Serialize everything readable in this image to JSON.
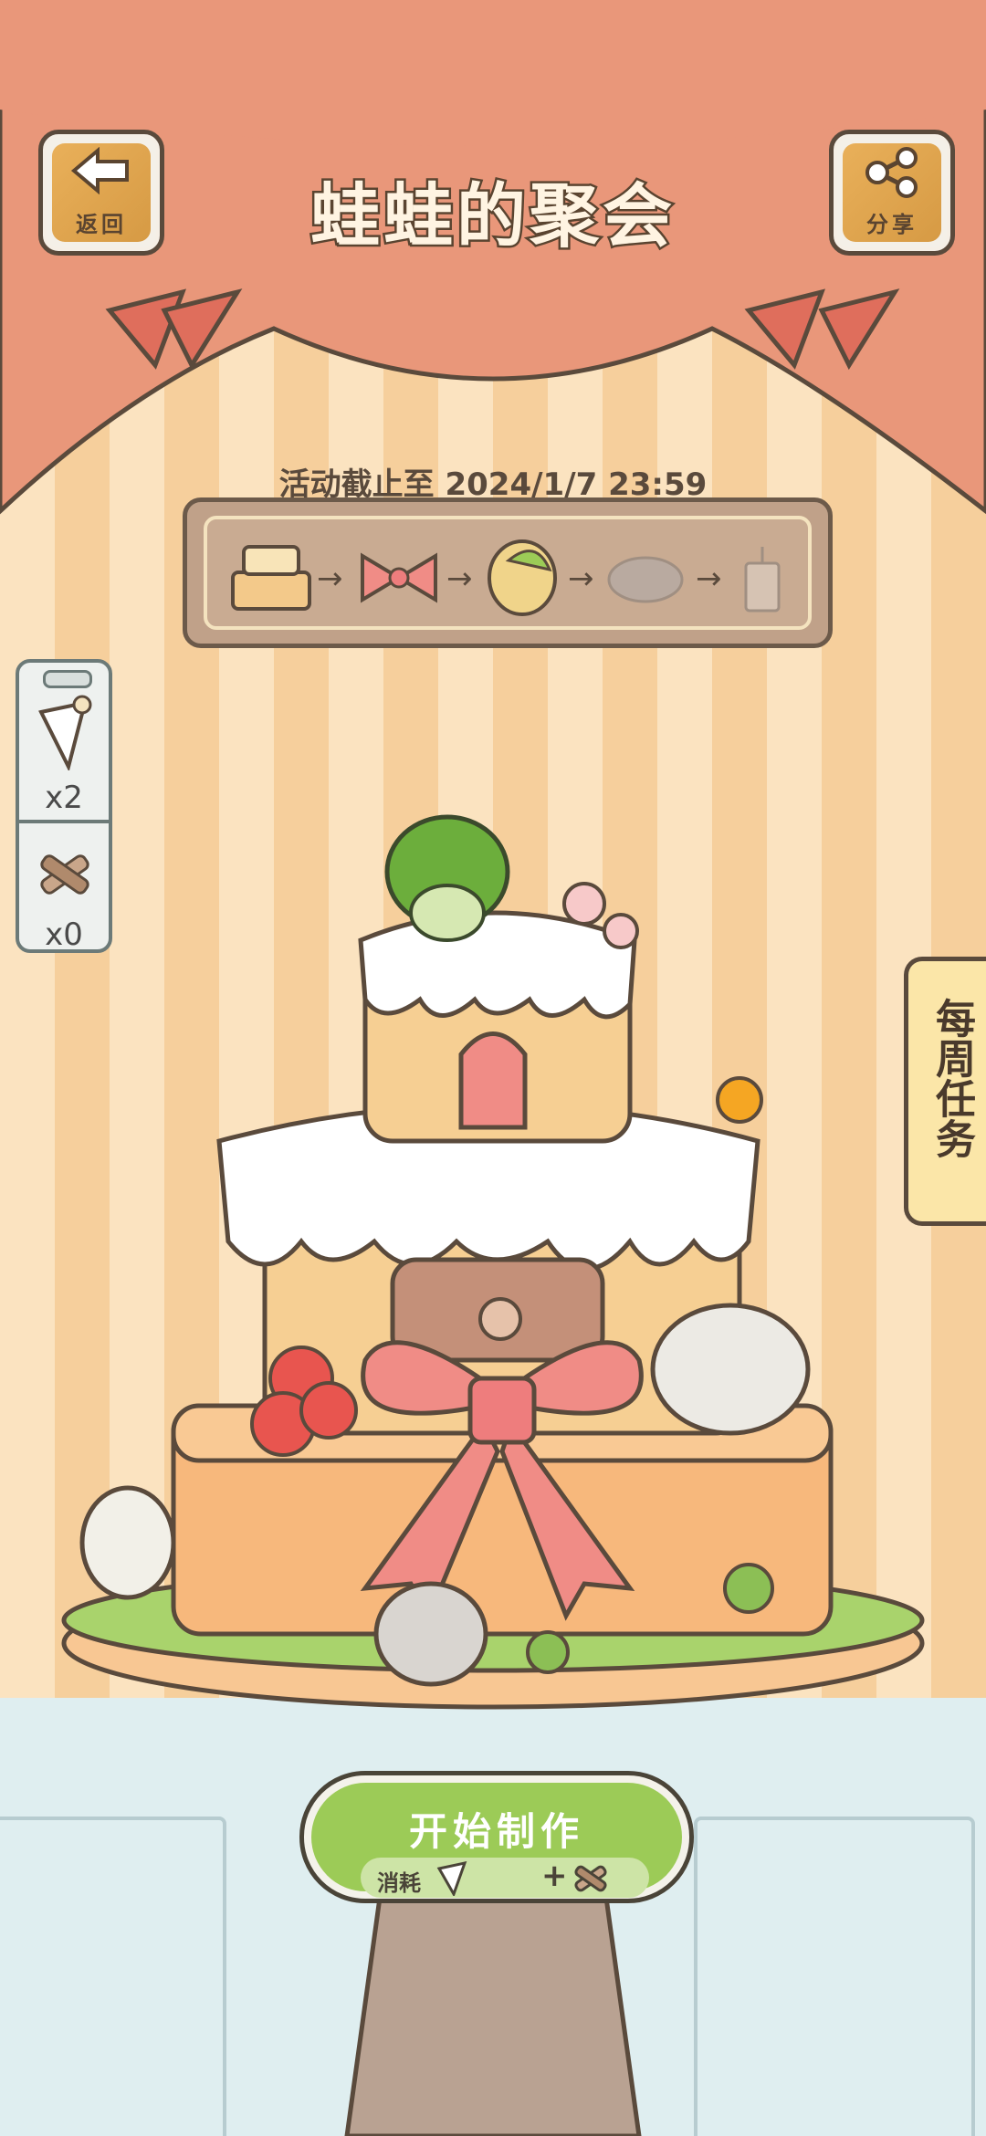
{
  "header": {
    "back_label": "返回",
    "title": "蛙蛙的聚会",
    "share_label": "分享"
  },
  "event": {
    "deadline": "活动截止至 2024/1/7 23:59"
  },
  "inventory": {
    "items": [
      {
        "icon": "piping-bag-icon",
        "count": "x2"
      },
      {
        "icon": "firewood-icon",
        "count": "x0"
      }
    ]
  },
  "weekly_tasks_label": "每周任务",
  "action": {
    "start_label": "开始制作",
    "cost_label": "消耗"
  },
  "colors": {
    "curtain": "#e9977a",
    "start_button": "#9ccb57",
    "wall_stripe_light": "#fbe3c0",
    "wall_stripe_dark": "#f6cf9c"
  }
}
